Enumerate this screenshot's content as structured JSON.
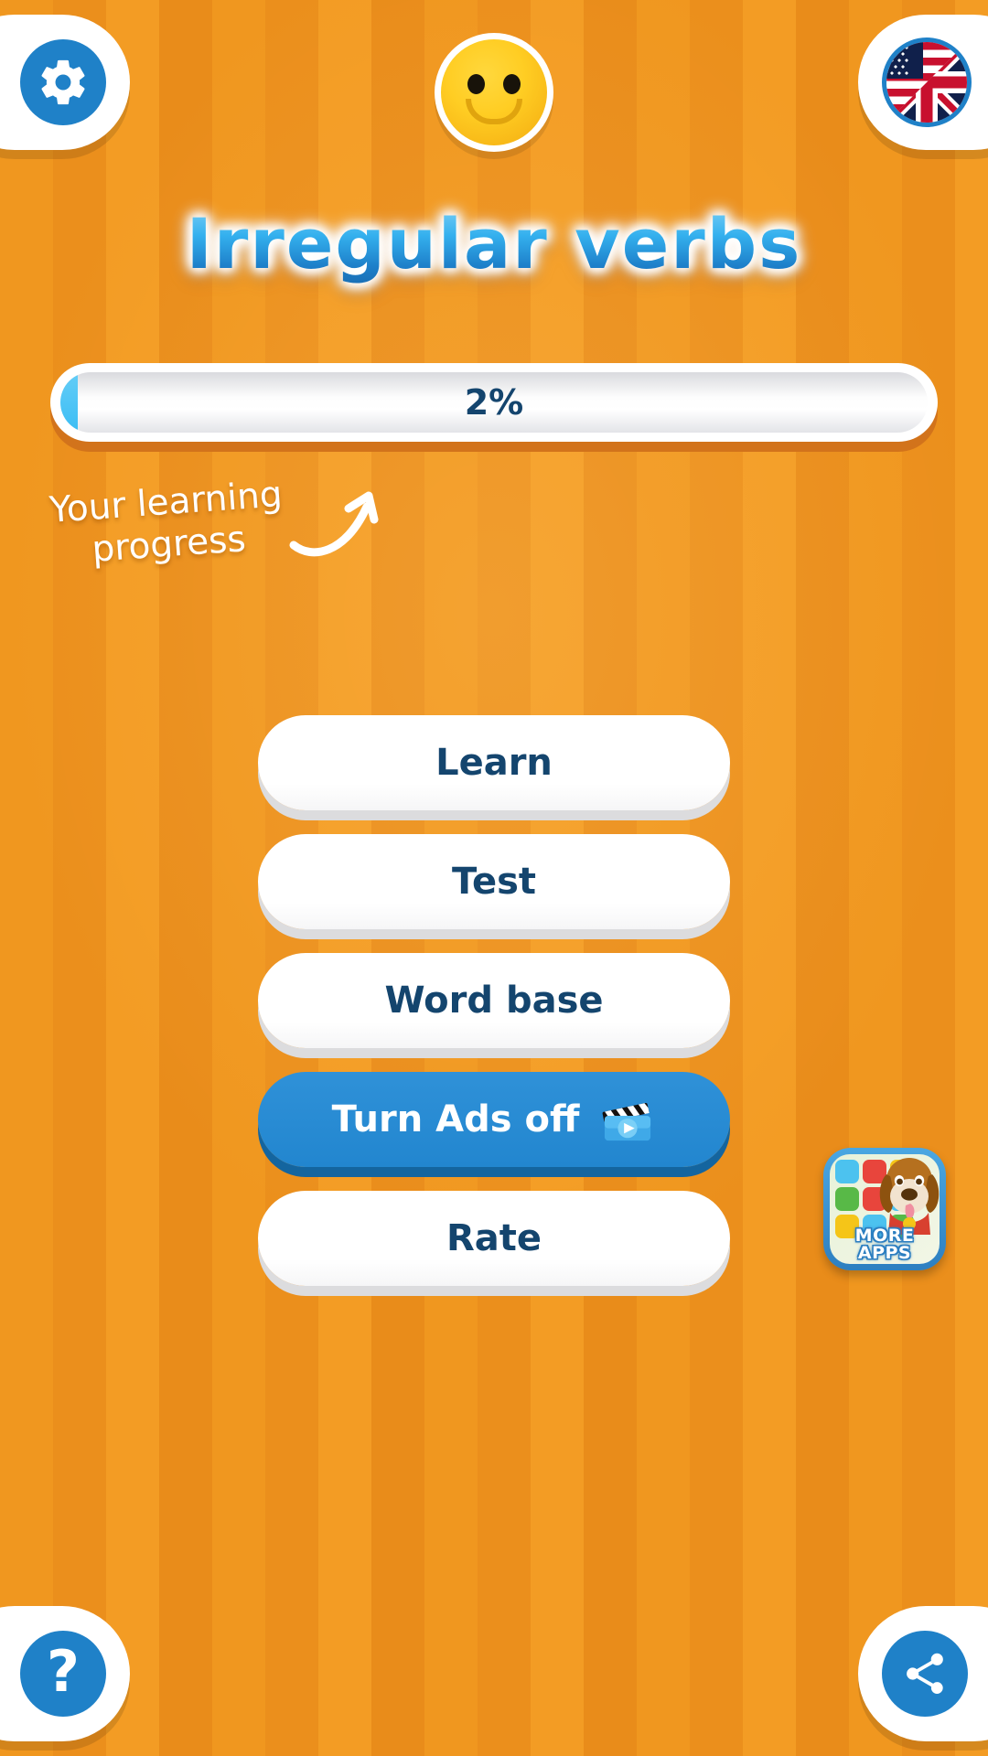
{
  "app": {
    "title": "Irregular verbs",
    "background_color": "#ef9422",
    "accent_color": "#2286cf",
    "text_color": "#14456e"
  },
  "header": {
    "settings_icon": "gear-icon",
    "mascot_icon": "smiley-face-icon",
    "language_icon": "us-uk-flag-icon"
  },
  "progress": {
    "percent_label": "2%",
    "percent_value": 2,
    "fill_color": "#3bbdf4"
  },
  "hint": {
    "line1": "Your learning",
    "line2": "progress",
    "arrow_icon": "curved-arrow-up-icon"
  },
  "menu": {
    "items": [
      {
        "label": "Learn",
        "style": "light",
        "icon": null
      },
      {
        "label": "Test",
        "style": "light",
        "icon": null
      },
      {
        "label": "Word base",
        "style": "light",
        "icon": null
      },
      {
        "label": "Turn Ads off",
        "style": "accent",
        "icon": "video-clapperboard-icon"
      },
      {
        "label": "Rate",
        "style": "light",
        "icon": null
      }
    ]
  },
  "more_apps": {
    "line1": "MORE",
    "line2": "APPS",
    "icon": "dog-mascot-icon"
  },
  "footer": {
    "help_label": "?",
    "help_icon": "question-mark-icon",
    "share_icon": "share-icon"
  }
}
